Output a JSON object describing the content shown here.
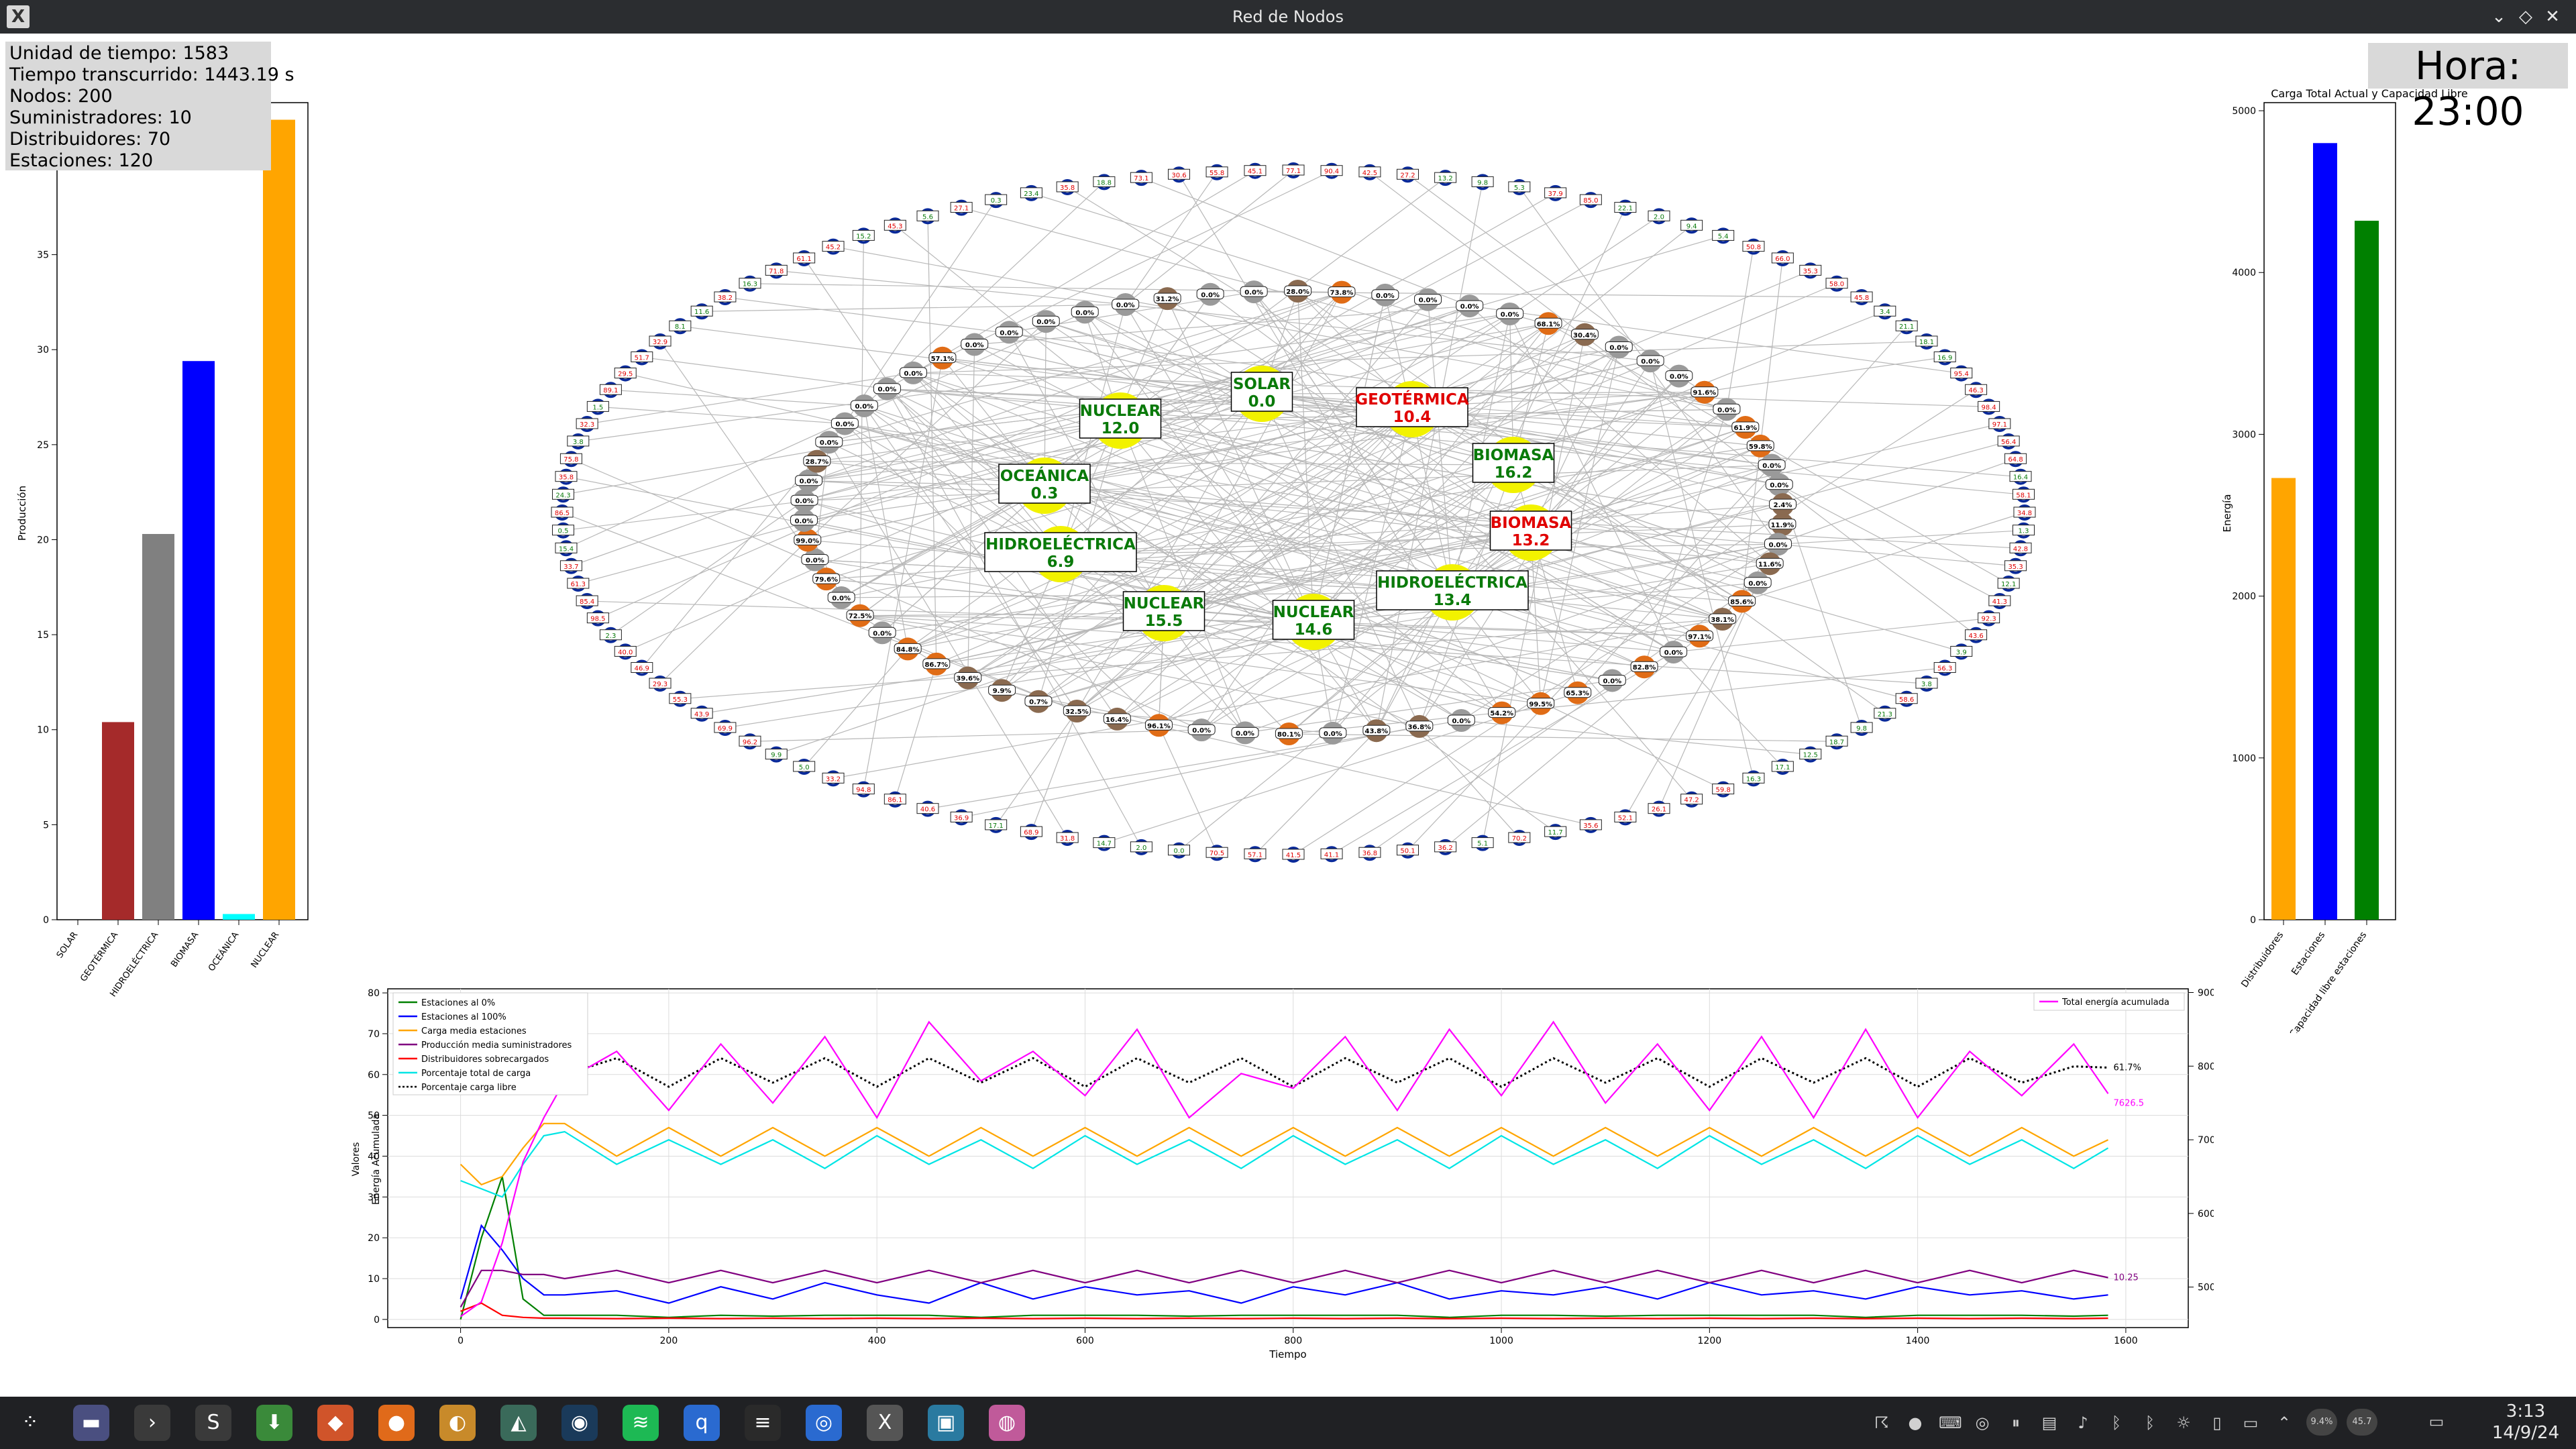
{
  "window": {
    "title": "Red de Nodos",
    "app_icon": "x-icon"
  },
  "stats": {
    "time_unit": "Unidad de tiempo: 1583",
    "elapsed": "Tiempo transcurrido: 1443.19 s",
    "nodes": "Nodos: 200",
    "suppliers": "Suministradores: 10",
    "distributors": "Distribuidores: 70",
    "stations": "Estaciones: 120"
  },
  "clock_overlay": {
    "hora": "Hora: 23:00"
  },
  "colors": {
    "station_border": "#0a2a9a",
    "distributor_orange": "#e06c16",
    "supplier_yellow": "#f2f200",
    "text_green": "#0a7a0a",
    "text_red": "#e00000"
  },
  "network": {
    "suppliers": [
      {
        "name": "SOLAR",
        "value": "0.0",
        "status": "ok"
      },
      {
        "name": "GEOTÉRMICA",
        "value": "10.4",
        "status": "overload"
      },
      {
        "name": "NUCLEAR",
        "value": "12.0",
        "status": "ok"
      },
      {
        "name": "BIOMASA",
        "value": "16.2",
        "status": "ok"
      },
      {
        "name": "OCEÁNICA",
        "value": "0.3",
        "status": "ok"
      },
      {
        "name": "BIOMASA",
        "value": "13.2",
        "status": "overload"
      },
      {
        "name": "HIDROELÉCTRICA",
        "value": "6.9",
        "status": "ok"
      },
      {
        "name": "HIDROELÉCTRICA",
        "value": "13.4",
        "status": "ok"
      },
      {
        "name": "NUCLEAR",
        "value": "15.5",
        "status": "ok"
      },
      {
        "name": "NUCLEAR",
        "value": "14.6",
        "status": "ok"
      }
    ],
    "distributor_labels": [
      "0.0%",
      "31.2%",
      "0.0%",
      "0.0%",
      "28.0%",
      "73.8%",
      "0.0%",
      "0.0%",
      "0.0%",
      "0.0%",
      "68.1%",
      "30.4%",
      "0.0%",
      "0.0%",
      "0.0%",
      "91.6%",
      "0.0%",
      "61.9%",
      "59.8%",
      "0.0%",
      "0.0%",
      "2.4%",
      "11.9%",
      "0.0%",
      "11.6%",
      "0.0%",
      "85.6%",
      "38.1%",
      "97.1%",
      "0.0%",
      "82.8%",
      "0.0%",
      "65.3%",
      "99.5%",
      "54.2%",
      "0.0%",
      "36.8%",
      "43.8%",
      "0.0%",
      "80.1%",
      "0.0%",
      "0.0%",
      "96.1%",
      "16.4%",
      "32.5%",
      "0.7%",
      "9.9%",
      "39.6%",
      "86.7%",
      "84.8%",
      "0.0%",
      "72.5%",
      "0.0%",
      "79.6%",
      "0.0%",
      "99.0%",
      "0.0%",
      "0.0%",
      "0.0%",
      "28.7%",
      "0.0%",
      "0.0%",
      "0.0%",
      "0.0%",
      "0.0%",
      "57.1%",
      "0.0%",
      "0.0%",
      "0.0%",
      "0.0%"
    ],
    "station_labels": [
      "77.1",
      "90.4",
      "42.5",
      "27.2",
      "13.2",
      "9.8",
      "5.3",
      "37.9",
      "85.0",
      "22.1",
      "2.0",
      "9.4",
      "5.4",
      "50.8",
      "66.0",
      "35.3",
      "58.0",
      "45.8",
      "3.4",
      "21.1",
      "18.1",
      "16.9",
      "95.4",
      "46.3",
      "98.4",
      "97.1",
      "56.4",
      "64.8",
      "16.4",
      "58.1",
      "34.8",
      "1.3",
      "42.8",
      "35.3",
      "12.1",
      "41.3",
      "92.3",
      "43.6",
      "3.9",
      "56.3",
      "3.8",
      "58.6",
      "21.3",
      "9.8",
      "18.7",
      "12.5",
      "17.1",
      "16.3",
      "59.8",
      "47.2",
      "26.1",
      "52.1",
      "35.6",
      "11.7",
      "70.2",
      "5.1",
      "36.2",
      "50.1",
      "36.8",
      "41.1",
      "41.5",
      "57.1",
      "70.5",
      "0.0",
      "2.0",
      "14.7",
      "31.8",
      "68.9",
      "17.1",
      "36.9",
      "40.6",
      "86.1",
      "94.8",
      "33.2",
      "5.0",
      "9.9",
      "96.2",
      "69.9",
      "43.9",
      "55.3",
      "29.3",
      "46.9",
      "40.0",
      "2.3",
      "98.5",
      "85.4",
      "61.3",
      "33.7",
      "15.4",
      "0.5",
      "86.5",
      "24.3",
      "35.8",
      "75.8",
      "3.8",
      "32.3",
      "1.5",
      "89.1",
      "29.5",
      "51.7",
      "32.9",
      "8.1",
      "11.6",
      "38.2",
      "16.3",
      "71.8",
      "61.1",
      "45.2",
      "15.2",
      "45.3",
      "5.6",
      "27.1",
      "0.3",
      "23.4",
      "35.8",
      "18.8",
      "73.1",
      "30.6",
      "55.8",
      "45.1"
    ]
  },
  "left_chart": {
    "ylabel": "Producción",
    "yticks": [
      "0",
      "5",
      "10",
      "15",
      "20",
      "25",
      "30",
      "35",
      "40"
    ],
    "categories": [
      "SOLAR",
      "GEOTÉRMICA",
      "HIDROELÉCTRICA",
      "BIOMASA",
      "OCEÁNICA",
      "NUCLEAR"
    ]
  },
  "right_chart": {
    "title": "Carga Total Actual y Capacidad Libre",
    "ylabel": "Energía",
    "yticks": [
      "0",
      "1000",
      "2000",
      "3000",
      "4000",
      "5000"
    ],
    "categories": [
      "Distribuidores",
      "Estaciones",
      "Capacidad libre estaciones"
    ]
  },
  "bottom_chart": {
    "xlabel": "Tiempo",
    "ylabel": "Valores",
    "ylabel2": "Energía Acumulada",
    "xticks": [
      "0",
      "200",
      "400",
      "600",
      "800",
      "1000",
      "1200",
      "1400",
      "1600"
    ],
    "yticks": [
      "0",
      "10",
      "20",
      "30",
      "40",
      "50",
      "60",
      "70",
      "80"
    ],
    "y2ticks": [
      "5000",
      "6000",
      "7000",
      "8000",
      "9000"
    ],
    "legend_left": [
      {
        "label": "Estaciones al 0%",
        "color": "#008000",
        "dash": "solid"
      },
      {
        "label": "Estaciones al 100%",
        "color": "#0000ff",
        "dash": "solid"
      },
      {
        "label": "Carga media estaciones",
        "color": "#ffa500",
        "dash": "solid"
      },
      {
        "label": "Producción media suministradores",
        "color": "#800080",
        "dash": "solid"
      },
      {
        "label": "Distribuidores sobrecargados",
        "color": "#ff0000",
        "dash": "solid"
      },
      {
        "label": "Porcentaje total de carga",
        "color": "#00e5e5",
        "dash": "solid"
      },
      {
        "label": "Porcentaje carga libre",
        "color": "#000000",
        "dash": "dotted"
      }
    ],
    "legend_right": {
      "label": "Total energía acumulada",
      "color": "#ff00ff"
    },
    "end_labels": [
      {
        "text": "61.7%",
        "color": "#000000"
      },
      {
        "text": "7626.5",
        "color": "#ff00ff"
      },
      {
        "text": "10.25",
        "color": "#800080"
      }
    ]
  },
  "chart_data": [
    {
      "type": "bar",
      "title": "",
      "xlabel": "",
      "ylabel": "Producción",
      "categories": [
        "SOLAR",
        "GEOTÉRMICA",
        "HIDROELÉCTRICA",
        "BIOMASA",
        "OCEÁNICA",
        "NUCLEAR"
      ],
      "values": [
        0.0,
        10.4,
        20.3,
        29.4,
        0.3,
        42.1
      ],
      "colors": [
        "#ffff00",
        "#a52a2a",
        "#808080",
        "#0000ff",
        "#00ffff",
        "#ffa500"
      ],
      "ylim": [
        0,
        43
      ]
    },
    {
      "type": "bar",
      "title": "Carga Total Actual y Capacidad Libre",
      "xlabel": "",
      "ylabel": "Energía",
      "categories": [
        "Distribuidores",
        "Estaciones",
        "Capacidad libre estaciones"
      ],
      "values": [
        2730,
        4800,
        4320
      ],
      "colors": [
        "#ffa500",
        "#0000ff",
        "#008000"
      ],
      "ylim": [
        0,
        5050
      ]
    },
    {
      "type": "line",
      "title": "",
      "xlabel": "Tiempo",
      "ylabel": "Valores",
      "x": [
        0,
        20,
        40,
        60,
        80,
        100,
        150,
        200,
        250,
        300,
        350,
        400,
        450,
        500,
        550,
        600,
        650,
        700,
        750,
        800,
        850,
        900,
        950,
        1000,
        1050,
        1100,
        1150,
        1200,
        1250,
        1300,
        1350,
        1400,
        1450,
        1500,
        1550,
        1583
      ],
      "xlim": [
        -70,
        1660
      ],
      "ylim": [
        -2,
        81
      ],
      "series": [
        {
          "name": "Estaciones al 0%",
          "axis": "left",
          "color": "#008000",
          "values": [
            0,
            20,
            35,
            5,
            1,
            1,
            1,
            0.5,
            1,
            0.8,
            1,
            1,
            1,
            0.5,
            1,
            1,
            1,
            0.8,
            1,
            1,
            1,
            1,
            0.5,
            1,
            1,
            0.8,
            1,
            1,
            1,
            1,
            0.5,
            1,
            1,
            1,
            0.8,
            1
          ]
        },
        {
          "name": "Estaciones al 100%",
          "axis": "left",
          "color": "#0000ff",
          "values": [
            5,
            23,
            17,
            10,
            6,
            6,
            7,
            4,
            8,
            5,
            9,
            6,
            4,
            9,
            5,
            8,
            6,
            7,
            4,
            8,
            6,
            9,
            5,
            7,
            6,
            8,
            5,
            9,
            6,
            7,
            5,
            8,
            6,
            7,
            5,
            6
          ]
        },
        {
          "name": "Carga media estaciones",
          "axis": "left",
          "color": "#ffa500",
          "values": [
            38,
            33,
            35,
            42,
            48,
            48,
            40,
            47,
            40,
            47,
            40,
            47,
            40,
            47,
            40,
            47,
            40,
            47,
            40,
            47,
            40,
            47,
            40,
            47,
            40,
            47,
            40,
            47,
            40,
            47,
            40,
            47,
            40,
            47,
            40,
            44
          ]
        },
        {
          "name": "Producción media suministradores",
          "axis": "left",
          "color": "#800080",
          "values": [
            3,
            12,
            12,
            11,
            11,
            10,
            12,
            9,
            12,
            9,
            12,
            9,
            12,
            9,
            12,
            9,
            12,
            9,
            12,
            9,
            12,
            9,
            12,
            9,
            12,
            9,
            12,
            9,
            12,
            9,
            12,
            9,
            12,
            9,
            12,
            10.25
          ]
        },
        {
          "name": "Distribuidores sobrecargados",
          "axis": "left",
          "color": "#ff0000",
          "values": [
            2,
            4,
            1,
            0.5,
            0.3,
            0.3,
            0.2,
            0.3,
            0.2,
            0.3,
            0.2,
            0.3,
            0.2,
            0.3,
            0.2,
            0.3,
            0.2,
            0.3,
            0.2,
            0.3,
            0.2,
            0.3,
            0.2,
            0.3,
            0.2,
            0.3,
            0.2,
            0.3,
            0.2,
            0.3,
            0.2,
            0.3,
            0.2,
            0.3,
            0.2,
            0.3
          ]
        },
        {
          "name": "Porcentaje total de carga",
          "axis": "left",
          "color": "#00e5e5",
          "values": [
            34,
            32,
            30,
            38,
            45,
            46,
            38,
            44,
            38,
            44,
            37,
            45,
            38,
            44,
            37,
            45,
            38,
            44,
            37,
            45,
            38,
            44,
            37,
            45,
            38,
            44,
            37,
            45,
            38,
            44,
            37,
            45,
            38,
            44,
            37,
            42
          ]
        },
        {
          "name": "Porcentaje carga libre",
          "axis": "left",
          "color": "#000000",
          "dash": "dotted",
          "values": [
            null,
            null,
            null,
            null,
            null,
            60,
            64,
            57,
            64,
            58,
            64,
            57,
            64,
            58,
            64,
            57,
            64,
            58,
            64,
            57,
            64,
            58,
            64,
            57,
            64,
            58,
            64,
            57,
            64,
            58,
            64,
            57,
            64,
            58,
            62,
            61.7
          ]
        },
        {
          "name": "Total energía acumulada",
          "axis": "right",
          "color": "#ff00ff",
          "values": [
            4600,
            4800,
            5600,
            6700,
            7300,
            7800,
            8200,
            7400,
            8300,
            7500,
            8400,
            7300,
            8600,
            7800,
            8200,
            7600,
            8500,
            7300,
            7900,
            7700,
            8400,
            7400,
            8500,
            7600,
            8600,
            7500,
            8300,
            7400,
            8400,
            7300,
            8500,
            7300,
            8200,
            7600,
            8300,
            7626.5
          ]
        }
      ],
      "y2lim": [
        4450,
        9050
      ]
    }
  ],
  "taskbar": {
    "apps": [
      "app-launcher-icon",
      "file-manager-icon",
      "terminal-icon",
      "sublime-icon",
      "downloader-icon",
      "brave-icon",
      "firefox-icon",
      "game-icon",
      "system-monitor-icon",
      "steam-icon",
      "spotify-icon",
      "qbittorrent-icon",
      "settings-icon",
      "chrome-icon",
      "x-window-icon",
      "image-viewer-icon",
      "disk-icon"
    ],
    "tray": [
      "notifications-icon",
      "input-method-icon",
      "keyboard-icon",
      "steam-tray-icon",
      "pause-icon",
      "clipboard-icon",
      "volume-icon",
      "bluetooth-icon",
      "bluetooth-icon-2",
      "brightness-icon",
      "phone-icon",
      "display-icon",
      "chevron-up-icon"
    ],
    "cpu": "9.4%",
    "gpu": "45.7",
    "time": "3:13",
    "date": "14/9/24"
  }
}
